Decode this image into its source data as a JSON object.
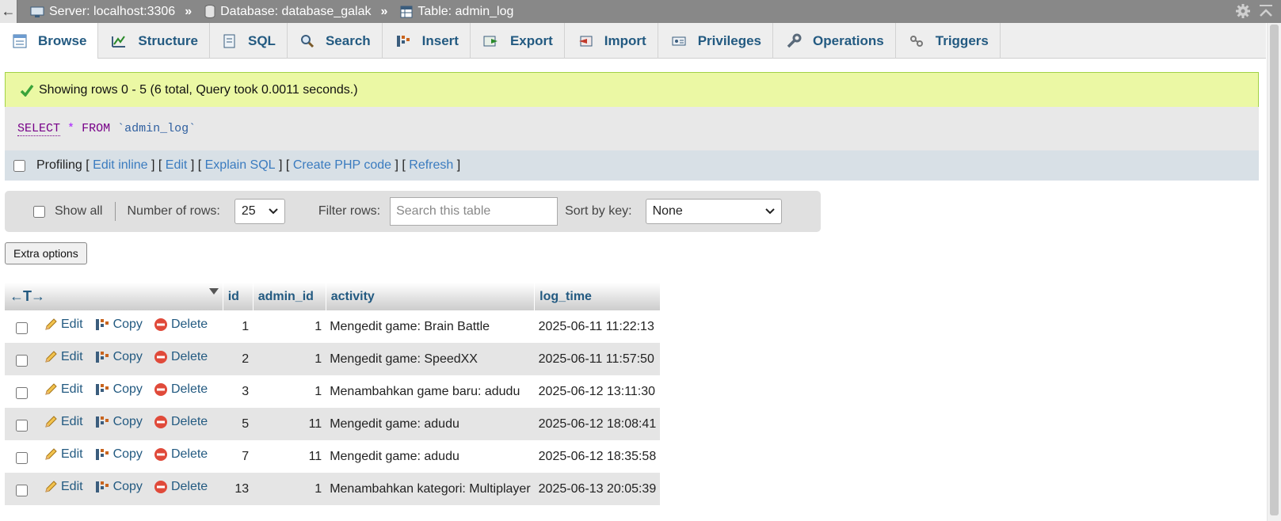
{
  "breadcrumb": {
    "back": "←",
    "server": "Server: localhost:3306",
    "database": "Database: database_galak",
    "table": "Table: admin_log",
    "sep": "»"
  },
  "tabs": [
    {
      "label": "Browse"
    },
    {
      "label": "Structure"
    },
    {
      "label": "SQL"
    },
    {
      "label": "Search"
    },
    {
      "label": "Insert"
    },
    {
      "label": "Export"
    },
    {
      "label": "Import"
    },
    {
      "label": "Privileges"
    },
    {
      "label": "Operations"
    },
    {
      "label": "Triggers"
    }
  ],
  "message": {
    "text": "Showing rows 0 - 5 (6 total, Query took 0.0011 seconds.)",
    "sql_keyword": "SELECT",
    "sql_star": "*",
    "sql_from": "FROM",
    "sql_table": "`admin_log`"
  },
  "profiling": {
    "label": "Profiling",
    "edit_inline": "Edit inline",
    "edit": "Edit",
    "explain": "Explain SQL",
    "php": "Create PHP code",
    "refresh": "Refresh",
    "lb": "[",
    "rb": "]",
    "mid": "] ["
  },
  "nav": {
    "show_all": "Show all",
    "rows_label": "Number of rows:",
    "rows_value": "25",
    "filter_label": "Filter rows:",
    "filter_placeholder": "Search this table",
    "sort_label": "Sort by key:",
    "sort_value": "None"
  },
  "extra_options": "Extra options",
  "table": {
    "arrows": "←T→",
    "headers": {
      "id": "id",
      "admin_id": "admin_id",
      "activity": "activity",
      "log_time": "log_time"
    },
    "actions": {
      "edit": "Edit",
      "copy": "Copy",
      "delete": "Delete"
    },
    "rows": [
      {
        "id": "1",
        "admin_id": "1",
        "activity": "Mengedit game: Brain Battle",
        "log_time": "2025-06-11 11:22:13"
      },
      {
        "id": "2",
        "admin_id": "1",
        "activity": "Mengedit game: SpeedXX",
        "log_time": "2025-06-11 11:57:50"
      },
      {
        "id": "3",
        "admin_id": "1",
        "activity": "Menambahkan game baru: adudu",
        "log_time": "2025-06-12 13:11:30"
      },
      {
        "id": "5",
        "admin_id": "11",
        "activity": "Mengedit game: adudu",
        "log_time": "2025-06-12 18:08:41"
      },
      {
        "id": "7",
        "admin_id": "11",
        "activity": "Mengedit game: adudu",
        "log_time": "2025-06-12 18:35:58"
      },
      {
        "id": "13",
        "admin_id": "1",
        "activity": "Menambahkan kategori: Multiplayer",
        "log_time": "2025-06-13 20:05:39"
      }
    ]
  }
}
